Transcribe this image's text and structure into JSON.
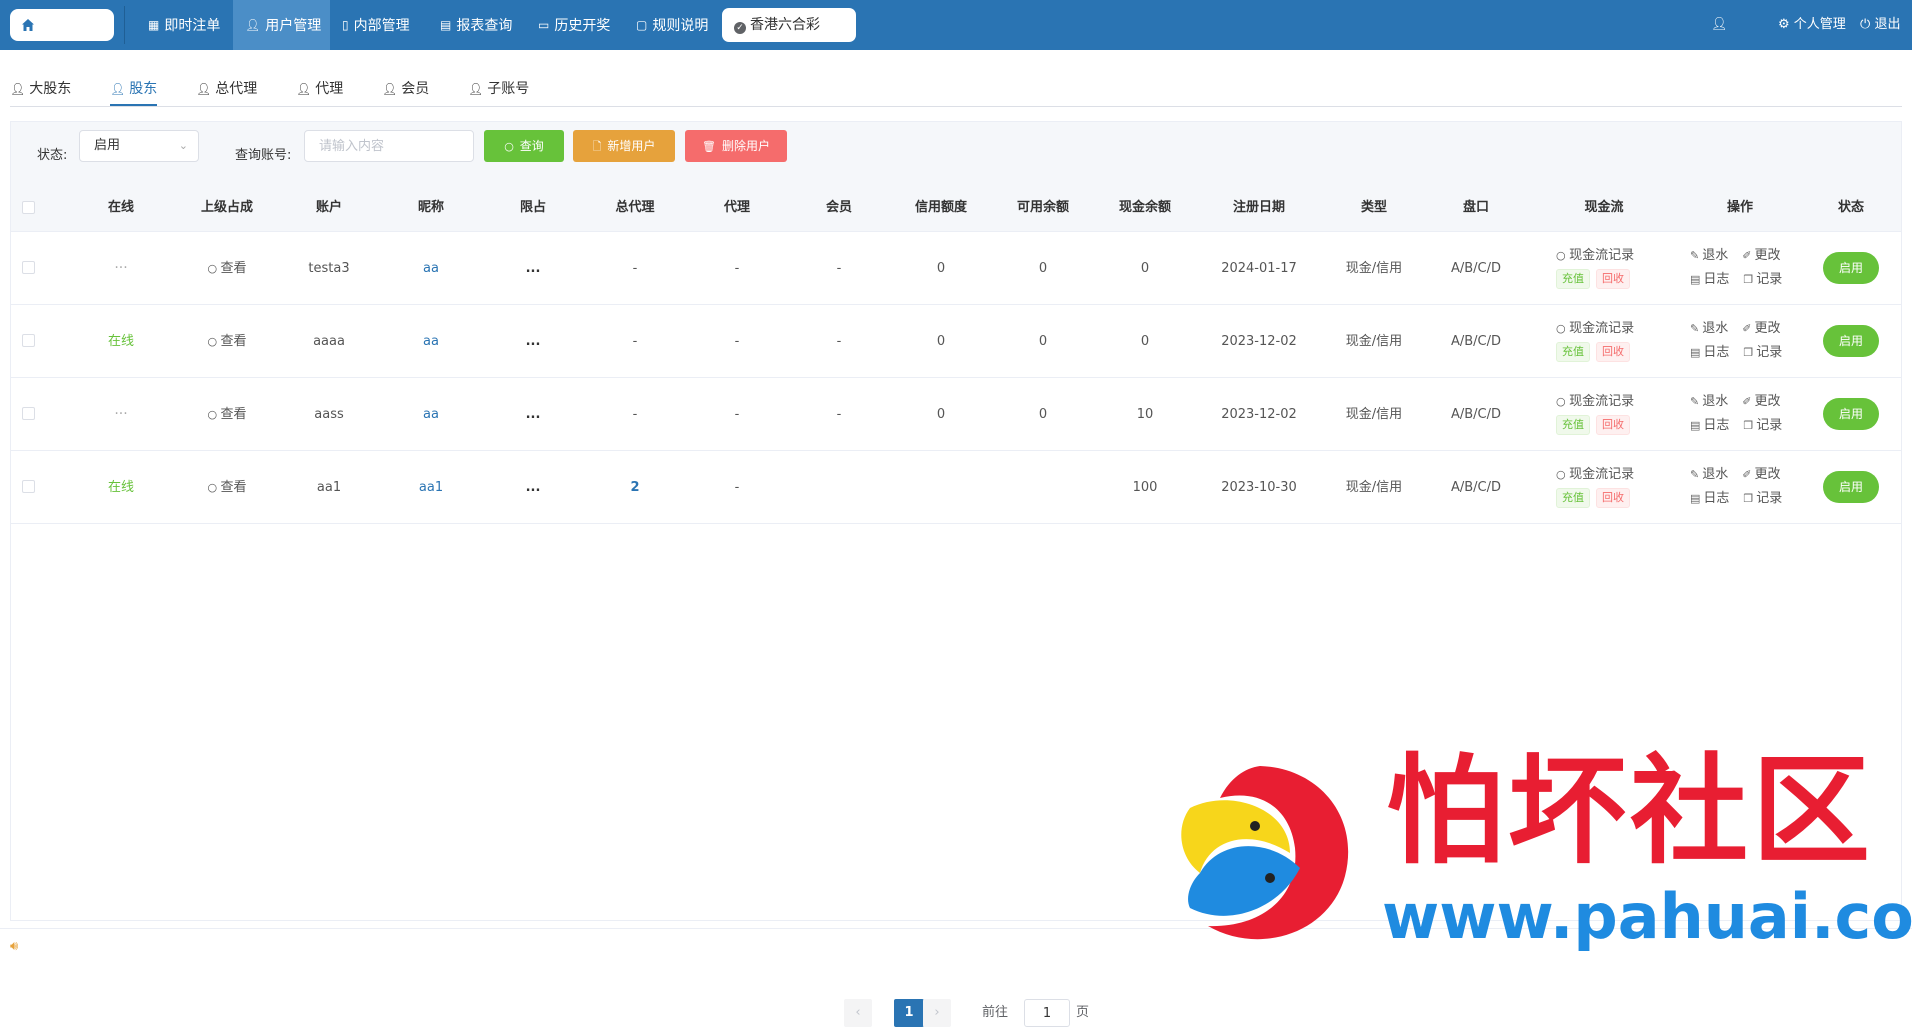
{
  "nav": {
    "items": [
      {
        "label": "即时注单"
      },
      {
        "label": "用户管理"
      },
      {
        "label": "内部管理"
      },
      {
        "label": "报表查询"
      },
      {
        "label": "历史开奖"
      },
      {
        "label": "规则说明"
      }
    ],
    "lottery": "香港六合彩",
    "personal": "个人管理",
    "logout": "退出"
  },
  "tabs": [
    "大股东",
    "股东",
    "总代理",
    "代理",
    "会员",
    "子账号"
  ],
  "filter": {
    "status_label": "状态:",
    "status_value": "启用",
    "account_label": "查询账号:",
    "account_placeholder": "请输入内容",
    "query_button": "查询",
    "add_button": "新增用户",
    "delete_button": "删除用户"
  },
  "table": {
    "headers": [
      "在线",
      "上级占成",
      "账户",
      "昵称",
      "限占",
      "总代理",
      "代理",
      "会员",
      "信用额度",
      "可用余额",
      "现金余额",
      "注册日期",
      "类型",
      "盘口",
      "现金流",
      "操作",
      "状态"
    ],
    "rows": [
      {
        "online": "···",
        "share": "查看",
        "account": "testa3",
        "nickname": "aa",
        "limit": "...",
        "general_agent": "-",
        "agent": "-",
        "member": "-",
        "credit": "0",
        "available": "0",
        "cash": "0",
        "reg_date": "2024-01-17",
        "type": "现金/信用",
        "handicap": "A/B/C/D",
        "status": "启用"
      },
      {
        "online": "在线",
        "share": "查看",
        "account": "aaaa",
        "nickname": "aa",
        "limit": "...",
        "general_agent": "-",
        "agent": "-",
        "member": "-",
        "credit": "0",
        "available": "0",
        "cash": "0",
        "reg_date": "2023-12-02",
        "type": "现金/信用",
        "handicap": "A/B/C/D",
        "status": "启用"
      },
      {
        "online": "···",
        "share": "查看",
        "account": "aass",
        "nickname": "aa",
        "limit": "...",
        "general_agent": "-",
        "agent": "-",
        "member": "-",
        "credit": "0",
        "available": "0",
        "cash": "10",
        "reg_date": "2023-12-02",
        "type": "现金/信用",
        "handicap": "A/B/C/D",
        "status": "启用"
      },
      {
        "online": "在线",
        "share": "查看",
        "account": "aa1",
        "nickname": "aa1",
        "limit": "...",
        "general_agent": "2",
        "agent": "-",
        "member": "",
        "credit": "",
        "available": "",
        "cash": "100",
        "reg_date": "2023-10-30",
        "type": "现金/信用",
        "handicap": "A/B/C/D",
        "status": "启用"
      }
    ],
    "cashflow": {
      "record": "现金流记录",
      "recharge": "充值",
      "recycle": "回收"
    },
    "ops": {
      "rebate": "退水",
      "edit": "更改",
      "log": "日志",
      "records": "记录"
    }
  },
  "pagination": {
    "current": "1",
    "goto_label": "前往",
    "goto_value": "1",
    "page_suffix": "页"
  },
  "watermark": {
    "text": "怕坏社区",
    "url": "www.pahuai.com"
  },
  "colors": {
    "primary": "#2a74b3",
    "success": "#67c23a",
    "warning": "#e6a23c",
    "danger": "#f56c6c",
    "watermark_red": "#e81e32",
    "watermark_blue": "#1f8be0"
  }
}
